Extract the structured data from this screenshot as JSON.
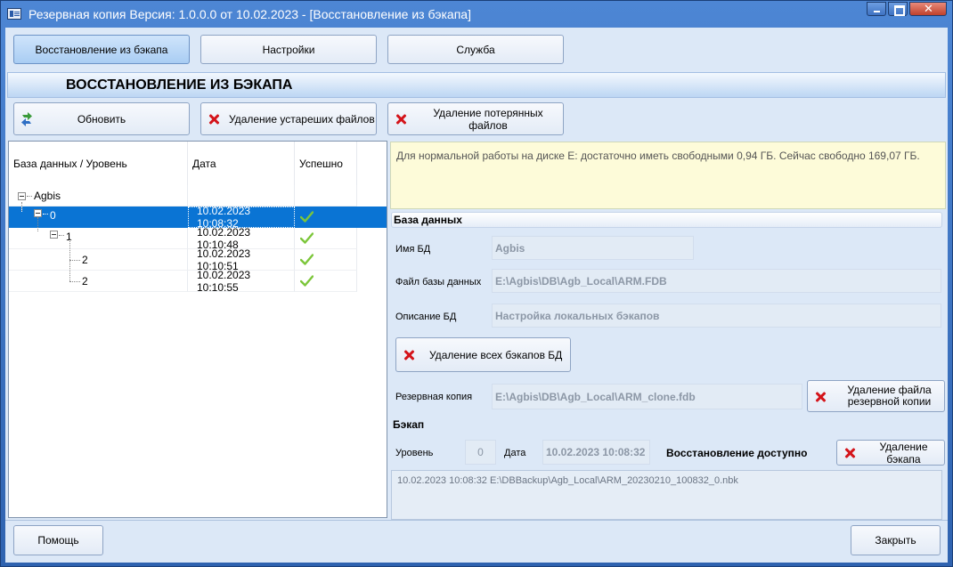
{
  "window": {
    "title": "Резервная копия   Версия: 1.0.0.0 от 10.02.2023 - [Восстановление из бэкапа]"
  },
  "tabs": [
    {
      "label": "Восстановление из бэкапа",
      "active": true
    },
    {
      "label": "Настройки",
      "active": false
    },
    {
      "label": "Служба",
      "active": false
    }
  ],
  "section": {
    "title": "ВОССТАНОВЛЕНИЕ ИЗ БЭКАПА"
  },
  "toolbar": {
    "refresh_label": "Обновить",
    "delete_old_label": "Удаление устареших файлов",
    "delete_lost_label": "Удаление потерянных файлов"
  },
  "tree": {
    "columns": [
      "База данных / Уровень",
      "Дата",
      "Успешно"
    ],
    "root": "Agbis",
    "rows": [
      {
        "label": "0",
        "date": "10.02.2023 10:08:32",
        "success": true,
        "selected": true
      },
      {
        "label": "1",
        "date": "10.02.2023 10:10:48",
        "success": true,
        "selected": false
      },
      {
        "label": "2",
        "date": "10.02.2023 10:10:51",
        "success": true,
        "selected": false
      },
      {
        "label": "2",
        "date": "10.02.2023 10:10:55",
        "success": true,
        "selected": false
      }
    ]
  },
  "info": {
    "text": "Для нормальной работы на диске E: достаточно иметь свободными 0,94 ГБ. Сейчас свободно 169,07 ГБ."
  },
  "database": {
    "header": "База данных",
    "name_label": "Имя БД",
    "name_value": "Agbis",
    "file_label": "Файл базы данных",
    "file_value": "E:\\Agbis\\DB\\Agb_Local\\ARM.FDB",
    "desc_label": "Описание БД",
    "desc_value": "Настройка локальных бэкапов",
    "delete_all_label": "Удаление всех бэкапов БД"
  },
  "backup_copy": {
    "label": "Резервная копия",
    "value": "E:\\Agbis\\DB\\Agb_Local\\ARM_clone.fdb",
    "delete_label_1": "Удаление файла",
    "delete_label_2": "резервной копии"
  },
  "backup": {
    "header": "Бэкап",
    "level_label": "Уровень",
    "level_value": "0",
    "date_label": "Дата",
    "date_value": "10.02.2023 10:08:32",
    "status": "Восстановление доступно",
    "delete_label": "Удаление бэкапа",
    "log": "10.02.2023 10:08:32 E:\\DBBackup\\Agb_Local\\ARM_20230210_100832_0.nbk"
  },
  "footer": {
    "help_label": "Помощь",
    "close_label": "Закрыть"
  },
  "colors": {
    "selection": "#0a74d4",
    "info_bg": "#fdfbd9",
    "check": "#7cc63a",
    "delete_icon": "#d4141a"
  }
}
